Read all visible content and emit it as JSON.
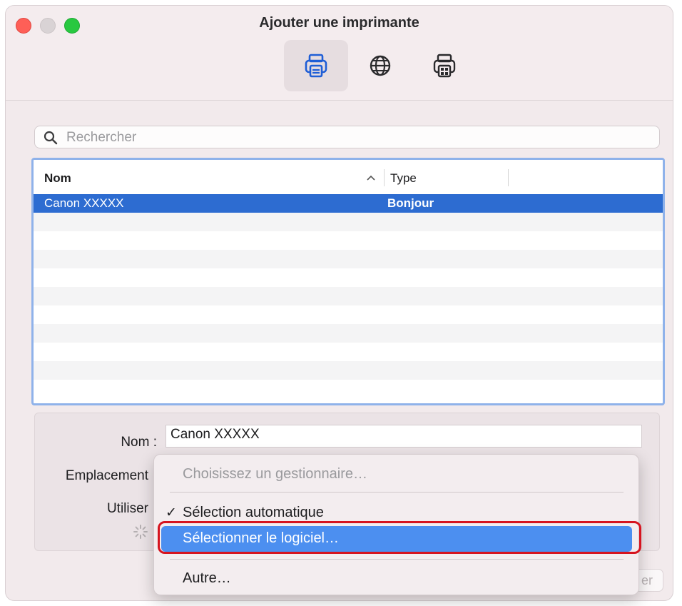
{
  "window": {
    "title": "Ajouter une imprimante"
  },
  "toolbar": {
    "buttons": [
      {
        "icon": "printer-default-icon",
        "active": true
      },
      {
        "icon": "globe-ip-icon",
        "active": false
      },
      {
        "icon": "printer-windows-icon",
        "active": false
      }
    ]
  },
  "search": {
    "placeholder": "Rechercher",
    "value": ""
  },
  "list": {
    "columns": {
      "name": "Nom",
      "type": "Type"
    },
    "rows": [
      {
        "name": "Canon XXXXX",
        "type": "Bonjour",
        "selected": true
      }
    ]
  },
  "details": {
    "name_label": "Nom :",
    "name_value": "Canon XXXXX",
    "location_label": "Emplacement",
    "use_label": "Utiliser"
  },
  "menu": {
    "header": "Choisissez un gestionnaire…",
    "checkmark": "✓",
    "auto_select": "Sélection automatique",
    "select_software": "Sélectionner le logiciel…",
    "other": "Autre…"
  },
  "footer": {
    "add_button_partial": "er"
  },
  "colors": {
    "accent": "#2d6cd1",
    "highlight": "#4c8ff0",
    "annotation": "#d6141f"
  }
}
